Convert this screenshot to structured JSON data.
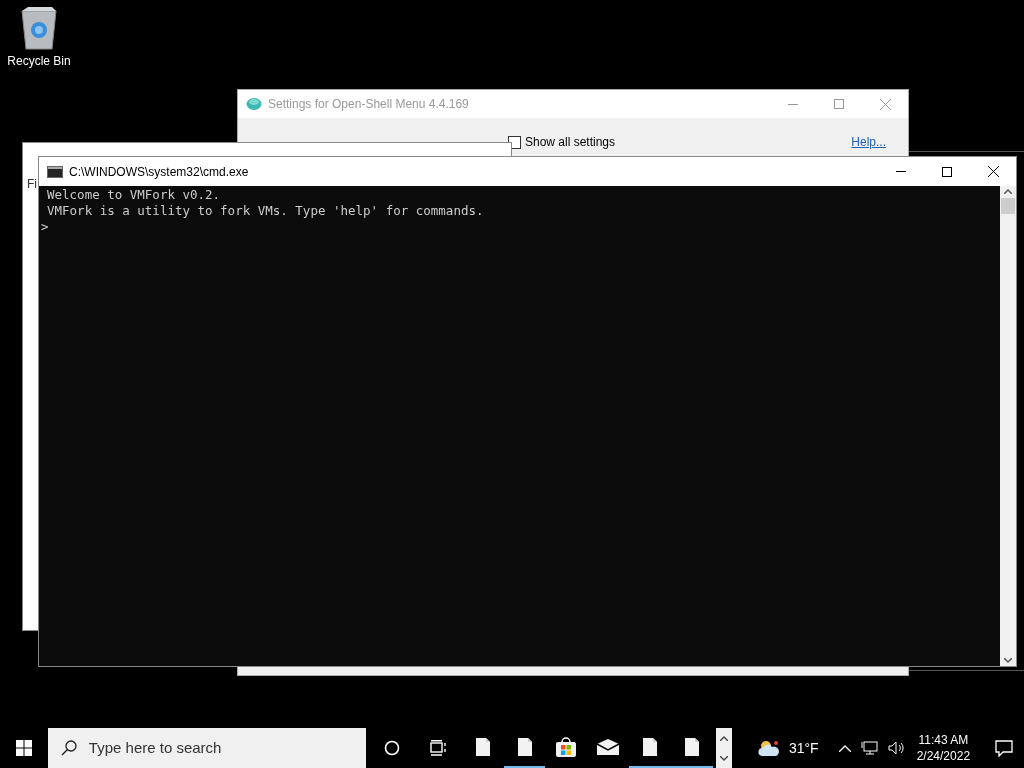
{
  "desktop_icons": [
    {
      "label": "Recycle Bin"
    }
  ],
  "settings_window": {
    "title": "Settings for Open-Shell Menu 4.4.169",
    "show_all": {
      "label": "Show all settings",
      "checked": false
    },
    "help_link": "Help..."
  },
  "vmfork_window": {
    "menu_fragment": "Fi"
  },
  "console_window": {
    "title": "C:\\WINDOWS\\system32\\cmd.exe",
    "lines": [
      "Welcome to VMFork v0.2.",
      "VMFork is a utility to fork VMs. Type 'help' for commands."
    ],
    "prompt": ">"
  },
  "taskbar": {
    "search": {
      "placeholder": "Type here to search"
    },
    "apps": [
      {
        "kind": "file",
        "running": false
      },
      {
        "kind": "file",
        "running": true
      },
      {
        "kind": "store",
        "running": false
      },
      {
        "kind": "mail",
        "running": false
      },
      {
        "kind": "file",
        "running": true
      },
      {
        "kind": "file",
        "running": true
      }
    ],
    "weather": {
      "temperature": "31°F"
    },
    "clock": {
      "time": "11:43 AM",
      "date": "2/24/2022"
    }
  }
}
